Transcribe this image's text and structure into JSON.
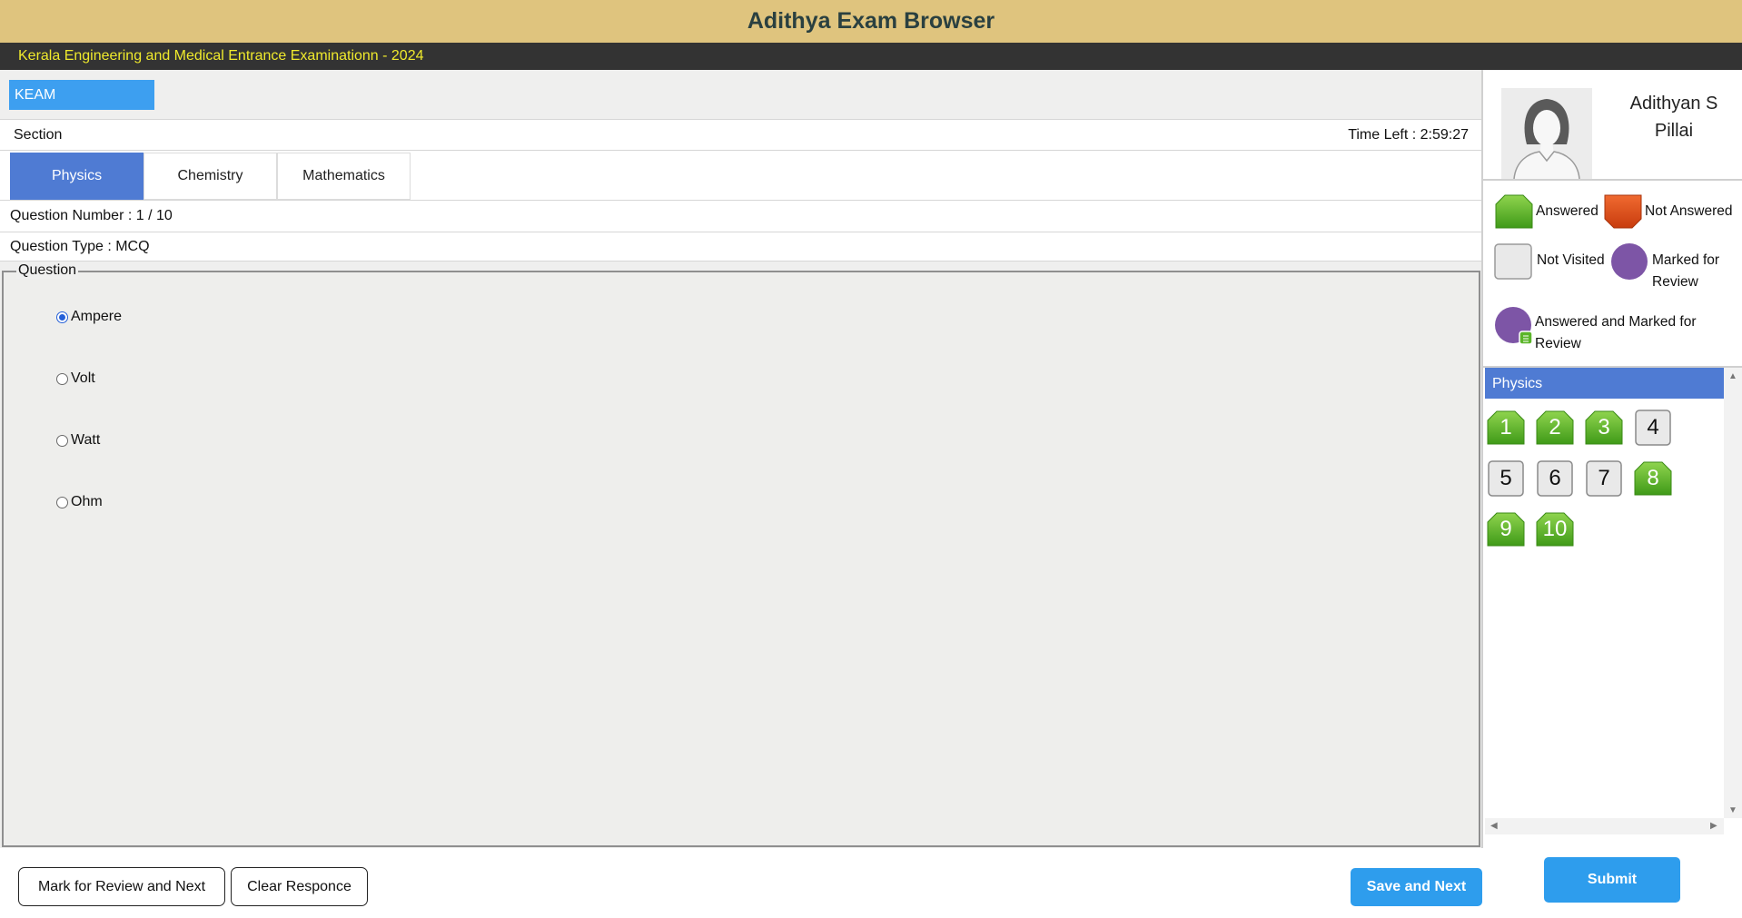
{
  "app": {
    "title": "Adithya Exam Browser"
  },
  "exam": {
    "name": "Kerala Engineering and Medical Entrance Examinationn - 2024",
    "code": "KEAM"
  },
  "section": {
    "label": "Section",
    "time_left": "Time Left : 2:59:27"
  },
  "tabs": [
    {
      "label": "Physics",
      "active": true
    },
    {
      "label": "Chemistry",
      "active": false
    },
    {
      "label": "Mathematics",
      "active": false
    }
  ],
  "question": {
    "number": "Question Number : 1 / 10",
    "type": "Question Type : MCQ",
    "legend": "Question",
    "options": [
      {
        "label": "Ampere",
        "selected": true
      },
      {
        "label": "Volt",
        "selected": false
      },
      {
        "label": "Watt",
        "selected": false
      },
      {
        "label": "Ohm",
        "selected": false
      }
    ]
  },
  "buttons": {
    "mark_review": "Mark for Review and Next",
    "clear": "Clear Responce",
    "save_next": "Save and Next",
    "submit": "Submit"
  },
  "candidate": {
    "name_line1": "Adithyan S",
    "name_line2": "Pillai"
  },
  "legend": {
    "answered": "Answered",
    "not_answered": "Not Answered",
    "not_visited": "Not Visited",
    "marked_line1": "Marked for",
    "marked_line2": "Review",
    "ans_marked_line1": "Answered and Marked for",
    "ans_marked_line2": "Review"
  },
  "palette": {
    "section": "Physics",
    "questions": [
      {
        "n": "1",
        "status": "answered"
      },
      {
        "n": "2",
        "status": "answered"
      },
      {
        "n": "3",
        "status": "answered"
      },
      {
        "n": "4",
        "status": "not-visited"
      },
      {
        "n": "5",
        "status": "not-visited"
      },
      {
        "n": "6",
        "status": "not-visited"
      },
      {
        "n": "7",
        "status": "not-visited"
      },
      {
        "n": "8",
        "status": "answered"
      },
      {
        "n": "9",
        "status": "answered"
      },
      {
        "n": "10",
        "status": "answered"
      }
    ]
  },
  "colors": {
    "title_bar": "#dfc47e",
    "answered": "#5bb52a",
    "not_answered": "#e2521c",
    "marked": "#7d55a6",
    "accent": "#4f7bd3"
  }
}
